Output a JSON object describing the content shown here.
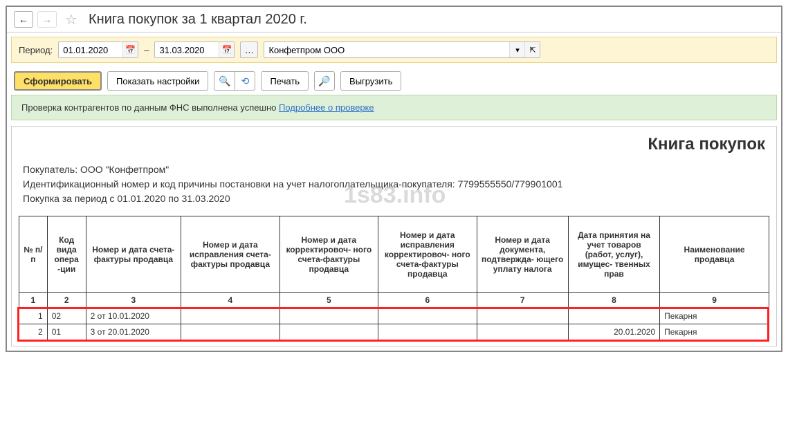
{
  "title": "Книга покупок за 1 квартал 2020 г.",
  "period": {
    "label": "Период:",
    "from": "01.01.2020",
    "dash": "–",
    "to": "31.03.2020"
  },
  "org": "Конфетпром ООО",
  "toolbar": {
    "generate": "Сформировать",
    "settings": "Показать настройки",
    "print": "Печать",
    "export": "Выгрузить"
  },
  "info": {
    "text": "Проверка контрагентов по данным ФНС выполнена успешно ",
    "link": "Подробнее о проверке"
  },
  "report": {
    "title": "Книга покупок",
    "buyer_label": "Покупатель:  ",
    "buyer": "ООО \"Конфетпром\"",
    "inn_label": "Идентификационный номер и код причины постановки на учет налогоплательщика-покупателя:  ",
    "inn": "7799555550/779901001",
    "period_text": "Покупка за период с 01.01.2020 по 31.03.2020",
    "watermark": "1s83.info"
  },
  "columns": [
    "№ п/п",
    "Код вида опера -ции",
    "Номер и дата счета-фактуры продавца",
    "Номер и дата исправления счета-фактуры продавца",
    "Номер и дата корректировоч- ного счета-фактуры продавца",
    "Номер и дата исправления корректировоч- ного счета-фактуры продавца",
    "Номер и дата документа, подтвержда- ющего уплату налога",
    "Дата принятия на учет товаров (работ, услуг), имущес- твенных прав",
    "Наименование продавца"
  ],
  "colnums": [
    "1",
    "2",
    "3",
    "4",
    "5",
    "6",
    "7",
    "8",
    "9"
  ],
  "rows": [
    {
      "n": "1",
      "code": "02",
      "sf": "2 от 10.01.2020",
      "c4": "",
      "c5": "",
      "c6": "",
      "c7": "",
      "date": "",
      "seller": "Пекарня"
    },
    {
      "n": "2",
      "code": "01",
      "sf": "3 от 20.01.2020",
      "c4": "",
      "c5": "",
      "c6": "",
      "c7": "",
      "date": "20.01.2020",
      "seller": "Пекарня"
    }
  ]
}
